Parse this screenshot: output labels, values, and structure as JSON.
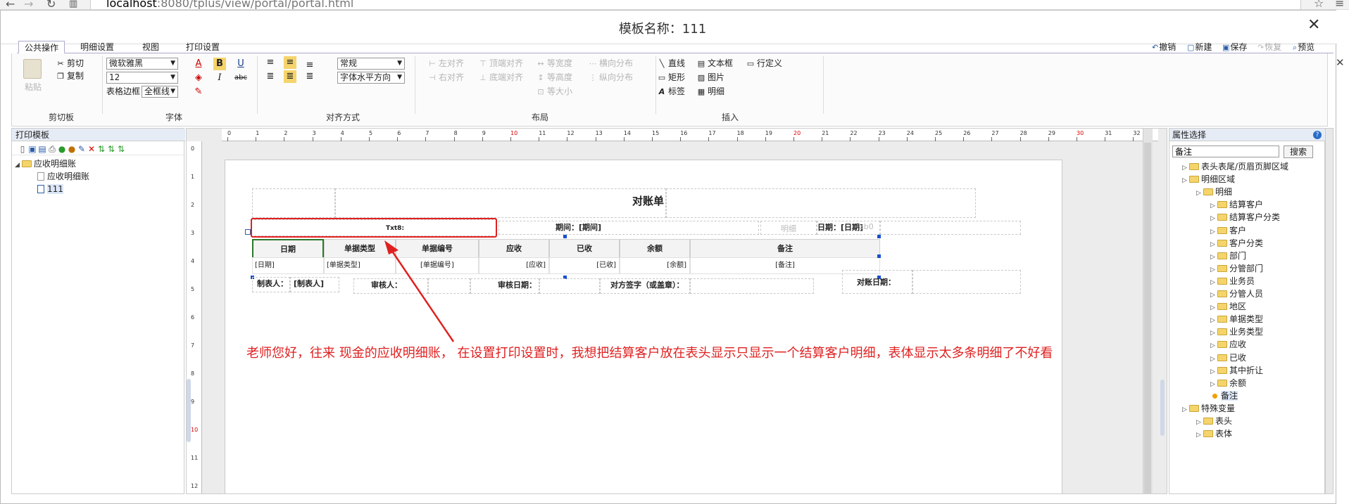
{
  "browser": {
    "url_host": "localhost",
    "url_rest": ":8080/tplus/view/portal/portal.html"
  },
  "dialog": {
    "title": "模板名称：111",
    "close": "✕",
    "edge_close": "✕"
  },
  "ribbon": {
    "tabs": [
      "公共操作",
      "明细设置",
      "视图",
      "打印设置"
    ],
    "right_actions": [
      {
        "label": "撤销",
        "icon": "↶",
        "enabled": true
      },
      {
        "label": "新建",
        "icon": "▢",
        "enabled": true
      },
      {
        "label": "保存",
        "icon": "▣",
        "enabled": true
      },
      {
        "label": "恢复",
        "icon": "↷",
        "enabled": false
      },
      {
        "label": "预览",
        "icon": "⌕",
        "enabled": true
      }
    ],
    "clipboard": {
      "paste": "粘贴",
      "cut": "剪切",
      "copy": "复制",
      "group": "剪切板"
    },
    "font": {
      "family": "微软雅黑",
      "size": "12",
      "border_label": "表格边框",
      "border_value": "全框线",
      "group": "字体",
      "color_btn": "A",
      "bold": "B",
      "underline": "U",
      "italic": "I",
      "strike": "abc"
    },
    "align": {
      "style": "常规",
      "text_dir": "字体水平方向",
      "group": "对齐方式"
    },
    "layout": {
      "items": [
        "左对齐",
        "顶端对齐",
        "等宽度",
        "横向分布",
        "右对齐",
        "底端对齐",
        "等高度",
        "纵向分布",
        "等大小"
      ],
      "group": "布局"
    },
    "insert": {
      "items": [
        "直线",
        "文本框",
        "行定义",
        "矩形",
        "图片",
        "标签",
        "明细"
      ],
      "group": "插入"
    }
  },
  "left_panel": {
    "title": "打印模板",
    "tree": [
      {
        "label": "应收明细账",
        "level": 0,
        "type": "folder"
      },
      {
        "label": "应收明细账",
        "level": 1,
        "type": "doc"
      },
      {
        "label": "111",
        "level": 1,
        "type": "template"
      }
    ]
  },
  "report": {
    "title": "对账单",
    "txt_label": "Txt8:",
    "period": "期间：[期间]",
    "date": "日期：[日期]",
    "ghost": "明细",
    "ghost2": "ab0",
    "columns": [
      "日期",
      "单据类型",
      "单据编号",
      "应收",
      "已收",
      "余额",
      "备注"
    ],
    "row": [
      "[日期]",
      "[单据类型]",
      "[单据编号]",
      "[应收]",
      "[已收]",
      "[余额]",
      "[备注]"
    ],
    "footer": [
      "制表人：",
      "[制表人]",
      "审核人：",
      "审核日期：",
      "对方签字（或盖章）：",
      "对账日期："
    ]
  },
  "ruler": {
    "top": [
      "0",
      "1",
      "2",
      "3",
      "4",
      "5",
      "6",
      "7",
      "8",
      "9",
      "10",
      "11",
      "12",
      "13",
      "14",
      "15",
      "16",
      "17",
      "18",
      "19",
      "20",
      "21",
      "22",
      "23",
      "24",
      "25",
      "26",
      "27",
      "28",
      "29",
      "30",
      "31",
      "32"
    ],
    "left": [
      "0",
      "1",
      "2",
      "3",
      "4",
      "5",
      "6",
      "7",
      "8",
      "9",
      "10",
      "11",
      "12"
    ]
  },
  "annotation": "老师您好，往来 现金的应收明细账， 在设置打印设置时，我想把结算客户放在表头显示只显示一个结算客户明细，表体显示太多条明细了不好看",
  "right_panel": {
    "title": "属性选择",
    "help": "?",
    "search_value": "备注",
    "search_btn": "搜索",
    "tree": [
      {
        "label": "表头表尾/页眉页脚区域",
        "level": 0
      },
      {
        "label": "明细区域",
        "level": 0
      },
      {
        "label": "明细",
        "level": 1
      },
      {
        "label": "结算客户",
        "level": 2
      },
      {
        "label": "结算客户分类",
        "level": 2
      },
      {
        "label": "客户",
        "level": 2
      },
      {
        "label": "客户分类",
        "level": 2
      },
      {
        "label": "部门",
        "level": 2
      },
      {
        "label": "分管部门",
        "level": 2
      },
      {
        "label": "业务员",
        "level": 2
      },
      {
        "label": "分管人员",
        "level": 2
      },
      {
        "label": "地区",
        "level": 2
      },
      {
        "label": "单据类型",
        "level": 2
      },
      {
        "label": "业务类型",
        "level": 2
      },
      {
        "label": "应收",
        "level": 2
      },
      {
        "label": "已收",
        "level": 2
      },
      {
        "label": "其中折让",
        "level": 2
      },
      {
        "label": "余额",
        "level": 2
      },
      {
        "label": "备注",
        "level": 2,
        "leaf": true
      },
      {
        "label": "特殊变量",
        "level": 0
      },
      {
        "label": "表头",
        "level": 1
      },
      {
        "label": "表体",
        "level": 1
      }
    ]
  }
}
